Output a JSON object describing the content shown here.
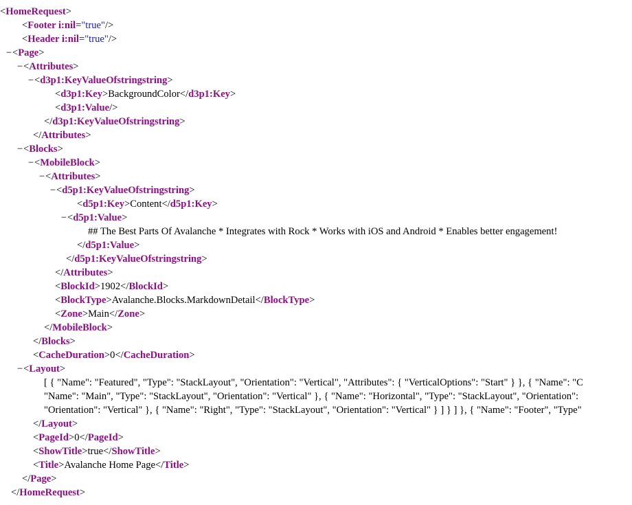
{
  "xml_viewer": {
    "toggle_symbol": "−",
    "lines": [
      {
        "t": 20,
        "ind": 0,
        "tog": true,
        "parts": [
          [
            "p",
            "<"
          ],
          [
            "t",
            "HomeRequest"
          ],
          [
            "p",
            ">"
          ]
        ]
      },
      {
        "t": 40,
        "ind": 30,
        "tog": false,
        "parts": [
          [
            "p",
            "<"
          ],
          [
            "t",
            "Footer i:nil"
          ],
          [
            "p",
            "="
          ],
          [
            "a",
            "\"true\""
          ],
          [
            "p",
            "/>"
          ]
        ]
      },
      {
        "t": 60,
        "ind": 30,
        "tog": false,
        "parts": [
          [
            "p",
            "<"
          ],
          [
            "t",
            "Header i:nil"
          ],
          [
            "p",
            "="
          ],
          [
            "a",
            "\"true\""
          ],
          [
            "p",
            "/>"
          ]
        ]
      },
      {
        "t": 80,
        "ind": 18,
        "tog": true,
        "parts": [
          [
            "p",
            "<"
          ],
          [
            "t",
            "Page"
          ],
          [
            "p",
            ">"
          ]
        ]
      },
      {
        "t": 100,
        "ind": 34,
        "tog": true,
        "parts": [
          [
            "p",
            "<"
          ],
          [
            "t",
            "Attributes"
          ],
          [
            "p",
            ">"
          ]
        ]
      },
      {
        "t": 120,
        "ind": 50,
        "tog": true,
        "parts": [
          [
            "p",
            "<"
          ],
          [
            "t",
            "d3p1:KeyValueOfstringstring"
          ],
          [
            "p",
            ">"
          ]
        ]
      },
      {
        "t": 140,
        "ind": 78,
        "tog": false,
        "parts": [
          [
            "p",
            "<"
          ],
          [
            "t",
            "d3p1:Key"
          ],
          [
            "p",
            ">"
          ],
          [
            "x",
            "BackgroundColor"
          ],
          [
            "p",
            "</"
          ],
          [
            "t",
            "d3p1:Key"
          ],
          [
            "p",
            ">"
          ]
        ]
      },
      {
        "t": 160,
        "ind": 78,
        "tog": false,
        "parts": [
          [
            "p",
            "<"
          ],
          [
            "t",
            "d3p1:Value"
          ],
          [
            "p",
            "/>"
          ]
        ]
      },
      {
        "t": 180,
        "ind": 62,
        "tog": false,
        "parts": [
          [
            "p",
            "</"
          ],
          [
            "t",
            "d3p1:KeyValueOfstringstring"
          ],
          [
            "p",
            ">"
          ]
        ]
      },
      {
        "t": 200,
        "ind": 46,
        "tog": false,
        "parts": [
          [
            "p",
            "</"
          ],
          [
            "t",
            "Attributes"
          ],
          [
            "p",
            ">"
          ]
        ]
      },
      {
        "t": 220,
        "ind": 34,
        "tog": true,
        "parts": [
          [
            "p",
            "<"
          ],
          [
            "t",
            "Blocks"
          ],
          [
            "p",
            ">"
          ]
        ]
      },
      {
        "t": 240,
        "ind": 50,
        "tog": true,
        "parts": [
          [
            "p",
            "<"
          ],
          [
            "t",
            "MobileBlock"
          ],
          [
            "p",
            ">"
          ]
        ]
      },
      {
        "t": 260,
        "ind": 66,
        "tog": true,
        "parts": [
          [
            "p",
            "<"
          ],
          [
            "t",
            "Attributes"
          ],
          [
            "p",
            ">"
          ]
        ]
      },
      {
        "t": 280,
        "ind": 82,
        "tog": true,
        "parts": [
          [
            "p",
            "<"
          ],
          [
            "t",
            "d5p1:KeyValueOfstringstring"
          ],
          [
            "p",
            ">"
          ]
        ]
      },
      {
        "t": 300,
        "ind": 110,
        "tog": false,
        "parts": [
          [
            "p",
            "<"
          ],
          [
            "t",
            "d5p1:Key"
          ],
          [
            "p",
            ">"
          ],
          [
            "x",
            "Content"
          ],
          [
            "p",
            "</"
          ],
          [
            "t",
            "d5p1:Key"
          ],
          [
            "p",
            ">"
          ]
        ]
      },
      {
        "t": 320,
        "ind": 98,
        "tog": true,
        "parts": [
          [
            "p",
            "<"
          ],
          [
            "t",
            "d5p1:Value"
          ],
          [
            "p",
            ">"
          ]
        ]
      },
      {
        "t": 340,
        "ind": 126,
        "tog": false,
        "parts": [
          [
            "x",
            "## The Best Parts Of Avalanche * Integrates with Rock * Works with iOS and Android * Enables better engagement!"
          ]
        ]
      },
      {
        "t": 360,
        "ind": 110,
        "tog": false,
        "parts": [
          [
            "p",
            "</"
          ],
          [
            "t",
            "d5p1:Value"
          ],
          [
            "p",
            ">"
          ]
        ]
      },
      {
        "t": 380,
        "ind": 94,
        "tog": false,
        "parts": [
          [
            "p",
            "</"
          ],
          [
            "t",
            "d5p1:KeyValueOfstringstring"
          ],
          [
            "p",
            ">"
          ]
        ]
      },
      {
        "t": 400,
        "ind": 78,
        "tog": false,
        "parts": [
          [
            "p",
            "</"
          ],
          [
            "t",
            "Attributes"
          ],
          [
            "p",
            ">"
          ]
        ]
      },
      {
        "t": 420,
        "ind": 78,
        "tog": false,
        "parts": [
          [
            "p",
            "<"
          ],
          [
            "t",
            "BlockId"
          ],
          [
            "p",
            ">"
          ],
          [
            "x",
            "1902"
          ],
          [
            "p",
            "</"
          ],
          [
            "t",
            "BlockId"
          ],
          [
            "p",
            ">"
          ]
        ]
      },
      {
        "t": 440,
        "ind": 78,
        "tog": false,
        "parts": [
          [
            "p",
            "<"
          ],
          [
            "t",
            "BlockType"
          ],
          [
            "p",
            ">"
          ],
          [
            "x",
            "Avalanche.Blocks.MarkdownDetail"
          ],
          [
            "p",
            "</"
          ],
          [
            "t",
            "BlockType"
          ],
          [
            "p",
            ">"
          ]
        ]
      },
      {
        "t": 460,
        "ind": 78,
        "tog": false,
        "parts": [
          [
            "p",
            "<"
          ],
          [
            "t",
            "Zone"
          ],
          [
            "p",
            ">"
          ],
          [
            "x",
            "Main"
          ],
          [
            "p",
            "</"
          ],
          [
            "t",
            "Zone"
          ],
          [
            "p",
            ">"
          ]
        ]
      },
      {
        "t": 480,
        "ind": 62,
        "tog": false,
        "parts": [
          [
            "p",
            "</"
          ],
          [
            "t",
            "MobileBlock"
          ],
          [
            "p",
            ">"
          ]
        ]
      },
      {
        "t": 500,
        "ind": 46,
        "tog": false,
        "parts": [
          [
            "p",
            "</"
          ],
          [
            "t",
            "Blocks"
          ],
          [
            "p",
            ">"
          ]
        ]
      },
      {
        "t": 520,
        "ind": 46,
        "tog": false,
        "parts": [
          [
            "p",
            "<"
          ],
          [
            "t",
            "CacheDuration"
          ],
          [
            "p",
            ">"
          ],
          [
            "x",
            "0"
          ],
          [
            "p",
            "</"
          ],
          [
            "t",
            "CacheDuration"
          ],
          [
            "p",
            ">"
          ]
        ]
      },
      {
        "t": 540,
        "ind": 34,
        "tog": true,
        "parts": [
          [
            "p",
            "<"
          ],
          [
            "t",
            "Layout"
          ],
          [
            "p",
            ">"
          ]
        ]
      },
      {
        "t": 560,
        "ind": 62,
        "tog": false,
        "parts": [
          [
            "x",
            "[ { \"Name\": \"Featured\", \"Type\": \"StackLayout\", \"Orientation\": \"Vertical\", \"Attributes\": { \"VerticalOptions\": \"Start\" } }, { \"Name\": \"C"
          ]
        ]
      },
      {
        "t": 580,
        "ind": 62,
        "tog": false,
        "parts": [
          [
            "x",
            "\"Name\": \"Main\", \"Type\": \"StackLayout\", \"Orientation\": \"Vertical\" }, { \"Name\": \"Horizontal\", \"Type\": \"StackLayout\", \"Orientation\":"
          ]
        ]
      },
      {
        "t": 600,
        "ind": 62,
        "tog": false,
        "parts": [
          [
            "x",
            "\"Orientation\": \"Vertical\" }, { \"Name\": \"Right\", \"Type\": \"StackLayout\", \"Orientation\": \"Vertical\" } ] } ] }, { \"Name\": \"Footer\", \"Type\""
          ]
        ]
      },
      {
        "t": 620,
        "ind": 46,
        "tog": false,
        "parts": [
          [
            "p",
            "</"
          ],
          [
            "t",
            "Layout"
          ],
          [
            "p",
            ">"
          ]
        ]
      },
      {
        "t": 640,
        "ind": 46,
        "tog": false,
        "parts": [
          [
            "p",
            "<"
          ],
          [
            "t",
            "PageId"
          ],
          [
            "p",
            ">"
          ],
          [
            "x",
            "0"
          ],
          [
            "p",
            "</"
          ],
          [
            "t",
            "PageId"
          ],
          [
            "p",
            ">"
          ]
        ]
      },
      {
        "t": 660,
        "ind": 46,
        "tog": false,
        "parts": [
          [
            "p",
            "<"
          ],
          [
            "t",
            "ShowTitle"
          ],
          [
            "p",
            ">"
          ],
          [
            "x",
            "true"
          ],
          [
            "p",
            "</"
          ],
          [
            "t",
            "ShowTitle"
          ],
          [
            "p",
            ">"
          ]
        ]
      },
      {
        "t": 680,
        "ind": 46,
        "tog": false,
        "parts": [
          [
            "p",
            "<"
          ],
          [
            "t",
            "Title"
          ],
          [
            "p",
            ">"
          ],
          [
            "x",
            "Avalanche Home Page"
          ],
          [
            "p",
            "</"
          ],
          [
            "t",
            "Title"
          ],
          [
            "p",
            ">"
          ]
        ]
      },
      {
        "t": 700,
        "ind": 30,
        "tog": false,
        "parts": [
          [
            "p",
            "</"
          ],
          [
            "t",
            "Page"
          ],
          [
            "p",
            ">"
          ]
        ]
      },
      {
        "t": 720,
        "ind": 14,
        "tog": false,
        "parts": [
          [
            "p",
            "</"
          ],
          [
            "t",
            "HomeRequest"
          ],
          [
            "p",
            ">"
          ]
        ]
      }
    ]
  }
}
